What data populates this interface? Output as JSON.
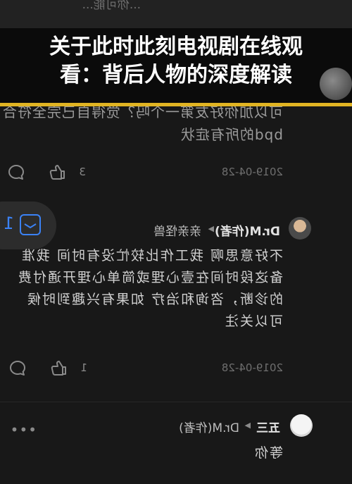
{
  "headline": {
    "line1": "关于此时此刻电视剧在线观",
    "line2": "看：背后人物的深度解读"
  },
  "top_comment": {
    "top_hint": "...你可能...",
    "text_line1": "可以加你好友第一个吗？觉得自己完全符合",
    "text_line2": "bpd的所有症状",
    "date": "2019-04-28",
    "like_count": "3"
  },
  "reply_1": {
    "author": "Dr.M(作者)",
    "reply_to": "亲亲怪兽",
    "text": "不好意思啊 我工作比较忙没有时间 我准备这段时间在壹心理或简单心理开通付费的诊断，咨询和治疗 如果有兴趣到时候可以关注",
    "date": "2019-04-28",
    "like_count": "1",
    "float_badge_count": "1"
  },
  "reply_2": {
    "author": "五三",
    "reply_to": "Dr.M(作者)",
    "text": "等你",
    "more_label": "•••"
  },
  "colors": {
    "background": "#181818",
    "accent_gold": "#e1b423",
    "accent_blue": "#3b82f6"
  },
  "icons": [
    "comment-icon",
    "like-icon",
    "inbox-icon",
    "more-icon",
    "avatar"
  ]
}
